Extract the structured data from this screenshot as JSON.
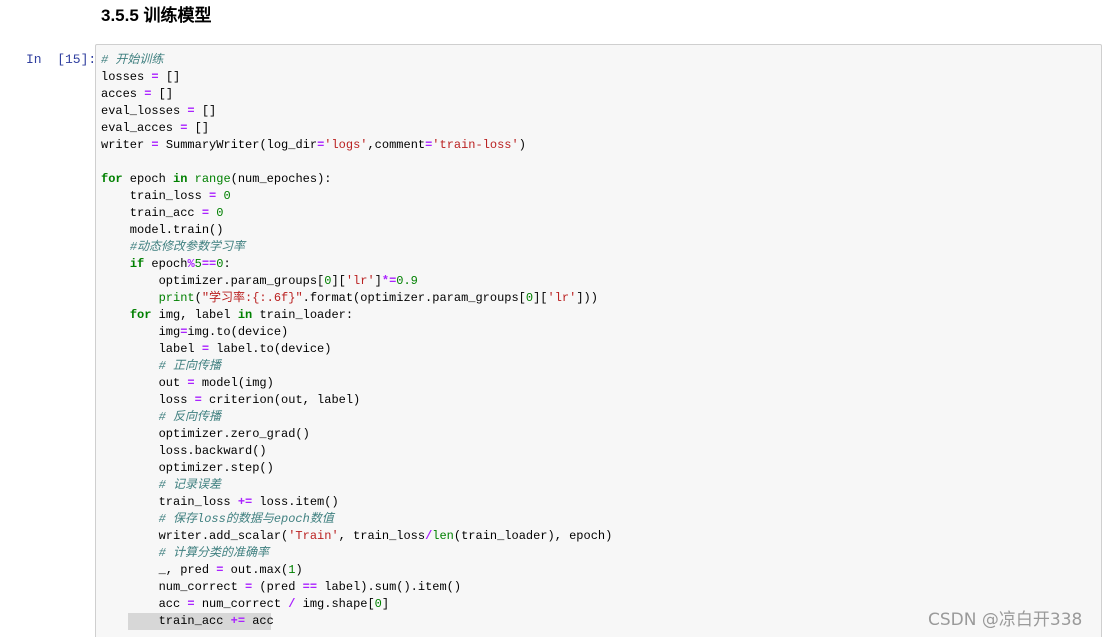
{
  "section_heading": "3.5.5 训练模型",
  "cell": {
    "prompt": "In  [15]:",
    "lines": [
      "# 开始训练",
      "losses = []",
      "acces = []",
      "eval_losses = []",
      "eval_acces = []",
      "writer = SummaryWriter(log_dir='logs',comment='train-loss')",
      "",
      "for epoch in range(num_epoches):",
      "    train_loss = 0",
      "    train_acc = 0",
      "    model.train()",
      "    #动态修改参数学习率",
      "    if epoch%5==0:",
      "        optimizer.param_groups[0]['lr']*=0.9",
      "        print(\"学习率:{:.6f}\".format(optimizer.param_groups[0]['lr']))",
      "    for img, label in train_loader:",
      "        img=img.to(device)",
      "        label = label.to(device)",
      "        # 正向传播",
      "        out = model(img)",
      "        loss = criterion(out, label)",
      "        # 反向传播",
      "        optimizer.zero_grad()",
      "        loss.backward()",
      "        optimizer.step()",
      "        # 记录误差",
      "        train_loss += loss.item()",
      "        # 保存loss的数据与epoch数值",
      "        writer.add_scalar('Train', train_loss/len(train_loader), epoch)",
      "        # 计算分类的准确率",
      "        _, pred = out.max(1)",
      "        num_correct = (pred == label).sum().item()",
      "        acc = num_correct / img.shape[0]",
      "        train_acc += acc"
    ]
  },
  "watermark": "CSDN @凉白开338",
  "colors": {
    "comment": "#408080",
    "keyword": "#008000",
    "string": "#ba2121",
    "operator": "#aa22ff",
    "prompt": "#303f9f",
    "cell_background": "#f7f7f7",
    "cell_border": "#cfcfcf"
  }
}
